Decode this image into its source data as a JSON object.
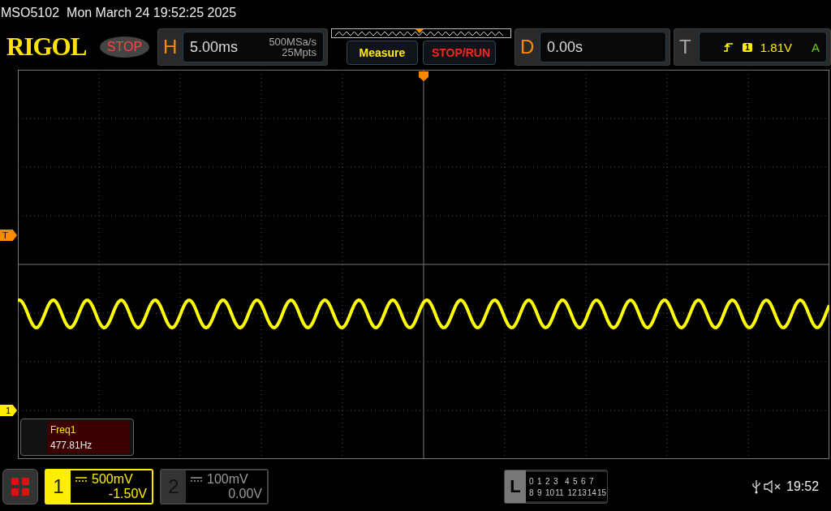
{
  "title_bar": {
    "model": "MSO5102",
    "datetime": "Mon March 24 19:52:25 2025"
  },
  "logo": "RIGOL",
  "run_state": "STOP",
  "horizontal": {
    "label": "H",
    "timebase": "5.00ms",
    "sample_rate": "500MSa/s",
    "memory_depth": "25Mpts"
  },
  "buttons": [
    {
      "label": "Measure",
      "kind": "measure"
    },
    {
      "label": "STOP/RUN",
      "kind": "run"
    }
  ],
  "delay": {
    "label": "D",
    "value": "0.00s"
  },
  "trigger": {
    "label": "T",
    "source": "1",
    "level": "1.81V",
    "mode": "A"
  },
  "markers": {
    "trigger_level": "T",
    "channel_1": "1"
  },
  "measurement": {
    "name": "Freq1",
    "value": "477.81Hz"
  },
  "channels": [
    {
      "number": "1",
      "scale": "500mV",
      "offset": "-1.50V",
      "selected": true
    },
    {
      "number": "2",
      "scale": "100mV",
      "offset": "0.00V",
      "selected": false
    }
  ],
  "logic": {
    "label": "L",
    "bits_row_1": [
      "0",
      "1",
      "2",
      "3",
      "4",
      "5",
      "6",
      "7"
    ],
    "bits_row_2": [
      "8",
      "9",
      "10",
      "11",
      "12",
      "13",
      "14",
      "15"
    ]
  },
  "status": {
    "time": "19:52"
  }
}
